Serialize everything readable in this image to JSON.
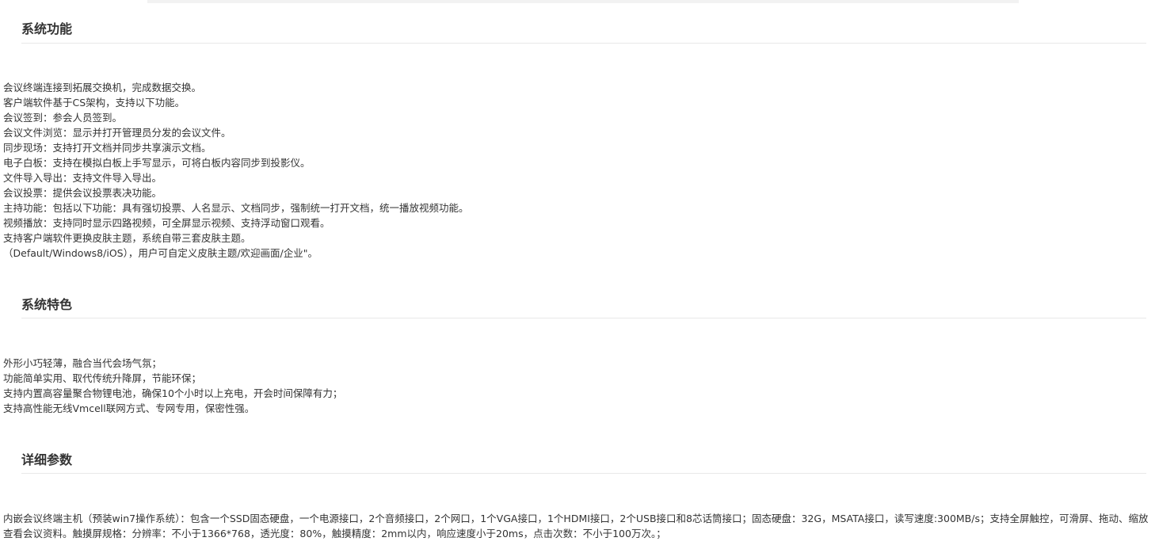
{
  "sections": {
    "features": {
      "title": "系统功能",
      "lines": [
        "会议终端连接到拓展交换机，完成数据交换。",
        "客户端软件基于CS架构，支持以下功能。",
        "会议签到：参会人员签到。",
        "会议文件浏览：显示并打开管理员分发的会议文件。",
        "同步现场：支持打开文档并同步共享演示文档。",
        "电子白板：支持在模拟白板上手写显示，可将白板内容同步到投影仪。",
        "文件导入导出：支持文件导入导出。",
        "会议投票：提供会议投票表决功能。",
        "主持功能：包括以下功能：具有强切投票、人名显示、文档同步，强制统一打开文档，统一播放视频功能。",
        "视频播放：支持同时显示四路视频，可全屏显示视频、支持浮动窗口观看。",
        "支持客户端软件更换皮肤主题，系统自带三套皮肤主题。",
        "（Default/Windows8/iOS），用户可自定义皮肤主题/欢迎画面/企业\"。"
      ]
    },
    "characteristics": {
      "title": "系统特色",
      "lines": [
        "外形小巧轻薄，融合当代会场气氛；",
        "功能简单实用、取代传统升降屏，节能环保；",
        "支持内置高容量聚合物锂电池，确保10个小时以上充电，开会时间保障有力；",
        "支持高性能无线Vmcell联网方式、专网专用，保密性强。"
      ]
    },
    "parameters": {
      "title": "详细参数",
      "text": "内嵌会议终端主机（预装win7操作系统）：包含一个SSD固态硬盘，一个电源接口，2个音频接口，2个网口，1个VGA接口，1个HDMI接口，2个USB接口和8芯话筒接口；固态硬盘：32G，MSATA接口，读写速度:300MB/s；支持全屏触控，可滑屏、拖动、缩放查看会议资料。触摸屏规格：分辨率：不小于1366*768，透光度：80%，触摸精度：2mm以内，响应速度小于20ms，点击次数：不小于100万次。；"
    }
  }
}
